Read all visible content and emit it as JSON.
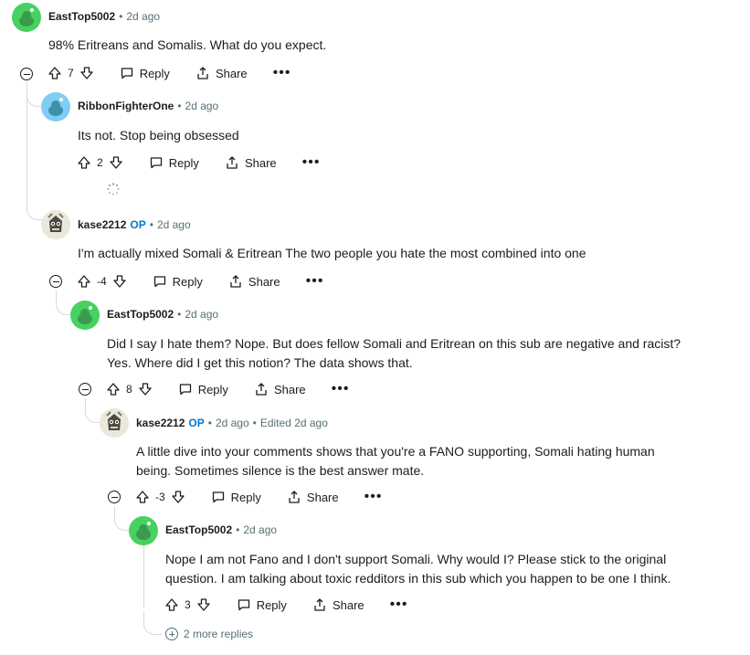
{
  "comments": [
    {
      "user": "EastTop5002",
      "time": "2d ago",
      "text": "98% Eritreans and Somalis. What do you expect.",
      "votes": "7",
      "reply": "Reply",
      "share": "Share"
    },
    {
      "user": "RibbonFighterOne",
      "time": "2d ago",
      "text": "Its not. Stop being obsessed",
      "votes": "2",
      "reply": "Reply",
      "share": "Share"
    },
    {
      "user": "kase2212",
      "op": "OP",
      "time": "2d ago",
      "text": "I'm actually mixed Somali & Eritrean The two people you hate the most combined into one",
      "votes": "-4",
      "reply": "Reply",
      "share": "Share"
    },
    {
      "user": "EastTop5002",
      "time": "2d ago",
      "text_line1": "Did I say I hate them? Nope. But does fellow Somali and Eritrean on this sub are negative and racist?",
      "text_line2": "Yes. Where did I get this notion? The data shows that.",
      "votes": "8",
      "reply": "Reply",
      "share": "Share"
    },
    {
      "user": "kase2212",
      "op": "OP",
      "time": "2d ago",
      "edited": "Edited 2d ago",
      "text_line1": "A little dive into your comments shows that you're a FANO supporting, Somali hating human",
      "text_line2": "being. Sometimes silence is the best answer mate.",
      "votes": "-3",
      "reply": "Reply",
      "share": "Share"
    },
    {
      "user": "EastTop5002",
      "time": "2d ago",
      "text_line1": "Nope I am not Fano and I don't support Somali. Why would I? Please stick to the original",
      "text_line2": "question. I am talking about toxic redditors in this sub which you happen to be one I think.",
      "votes": "3",
      "reply": "Reply",
      "share": "Share"
    }
  ],
  "more_replies": "2 more replies",
  "more_label": "•••",
  "colors": {
    "avatar_teal": "#46d160",
    "avatar_blue": "#7ecdf5",
    "op_blue": "#0079d3",
    "meta_gray": "#576f76"
  },
  "icons": [
    "upvote-icon",
    "downvote-icon",
    "comment-icon",
    "share-icon",
    "more-icon",
    "collapse-icon",
    "expand-icon",
    "loading-icon"
  ]
}
